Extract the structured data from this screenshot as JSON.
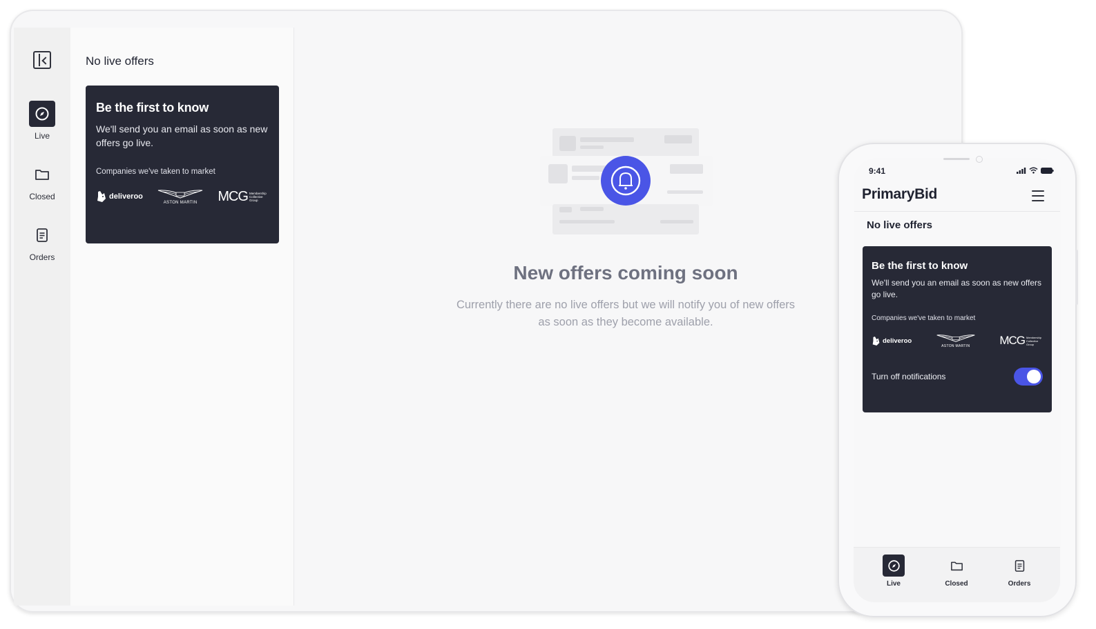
{
  "desktop": {
    "rail": {
      "items": [
        {
          "label": "Live",
          "icon": "compass-icon",
          "active": true
        },
        {
          "label": "Closed",
          "icon": "folder-icon",
          "active": false
        },
        {
          "label": "Orders",
          "icon": "document-icon",
          "active": false
        }
      ]
    },
    "list_panel": {
      "title": "No live offers",
      "promo": {
        "heading": "Be the first to know",
        "body": "We'll send you an email as soon as new offers go live.",
        "companies_label": "Companies we've taken to market",
        "logos": {
          "deliveroo": "deliveroo",
          "aston_martin": "ASTON MARTIN",
          "mcg": "MCG",
          "mcg_small": "Membership Collective Group"
        }
      }
    },
    "empty_state": {
      "title": "New offers coming soon",
      "description": "Currently there are no live offers but we will notify you of new offers as soon as they become available."
    }
  },
  "mobile": {
    "status": {
      "time": "9:41"
    },
    "brand": "PrimaryBid",
    "title": "No live offers",
    "promo": {
      "heading": "Be the first to know",
      "body": "We'll send you an email as soon as new offers go live.",
      "companies_label": "Companies we've taken to market",
      "logos": {
        "deliveroo": "deliveroo",
        "aston_martin": "ASTON MARTIN",
        "mcg": "MCG",
        "mcg_small": "Membership Collective Group"
      },
      "toggle_label": "Turn off notifications",
      "toggle_on": true
    },
    "tabs": [
      {
        "label": "Live",
        "icon": "compass-icon",
        "active": true
      },
      {
        "label": "Closed",
        "icon": "folder-icon",
        "active": false
      },
      {
        "label": "Orders",
        "icon": "document-icon",
        "active": false
      }
    ]
  },
  "colors": {
    "accent": "#4a55e6",
    "card_dark": "#272936",
    "muted_text": "#9ea0ab"
  }
}
